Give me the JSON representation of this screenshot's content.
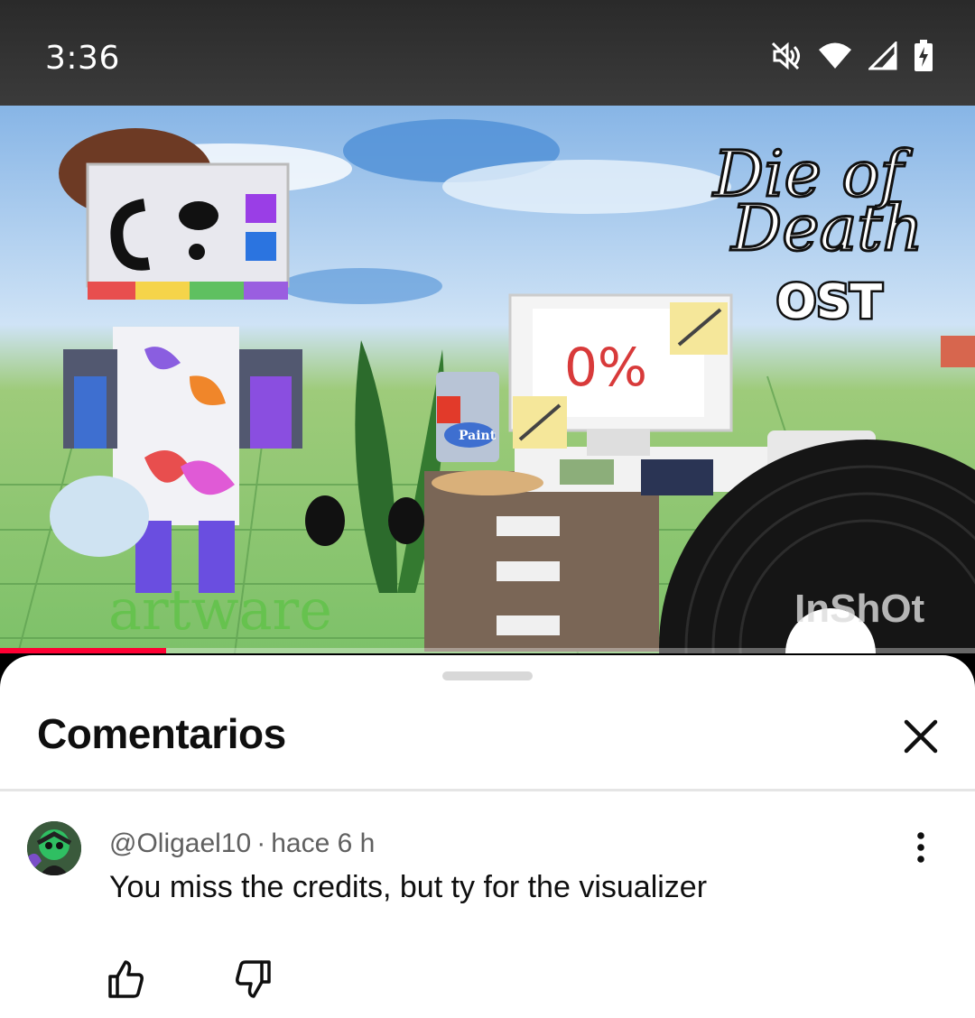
{
  "status_bar": {
    "time": "3:36",
    "icons": [
      "mute-icon",
      "wifi-icon",
      "signal-icon",
      "battery-charging-icon"
    ]
  },
  "video": {
    "thumbnail_title_line1": "Die of",
    "thumbnail_title_line2": "Death",
    "thumbnail_subtitle": "OST",
    "thumbnail_signature": "artware",
    "thumbnail_watermark": "InShOt",
    "paint_can_label": "Paint",
    "screen_text": "0%",
    "progress": 0.17,
    "progress_color": "#ff0033"
  },
  "comments_sheet": {
    "title": "Comentarios",
    "comments": [
      {
        "author": "@Oligael10",
        "separator": "·",
        "time": "hace 6 h",
        "text": "You miss the credits, but ty for the visualizer"
      }
    ]
  }
}
